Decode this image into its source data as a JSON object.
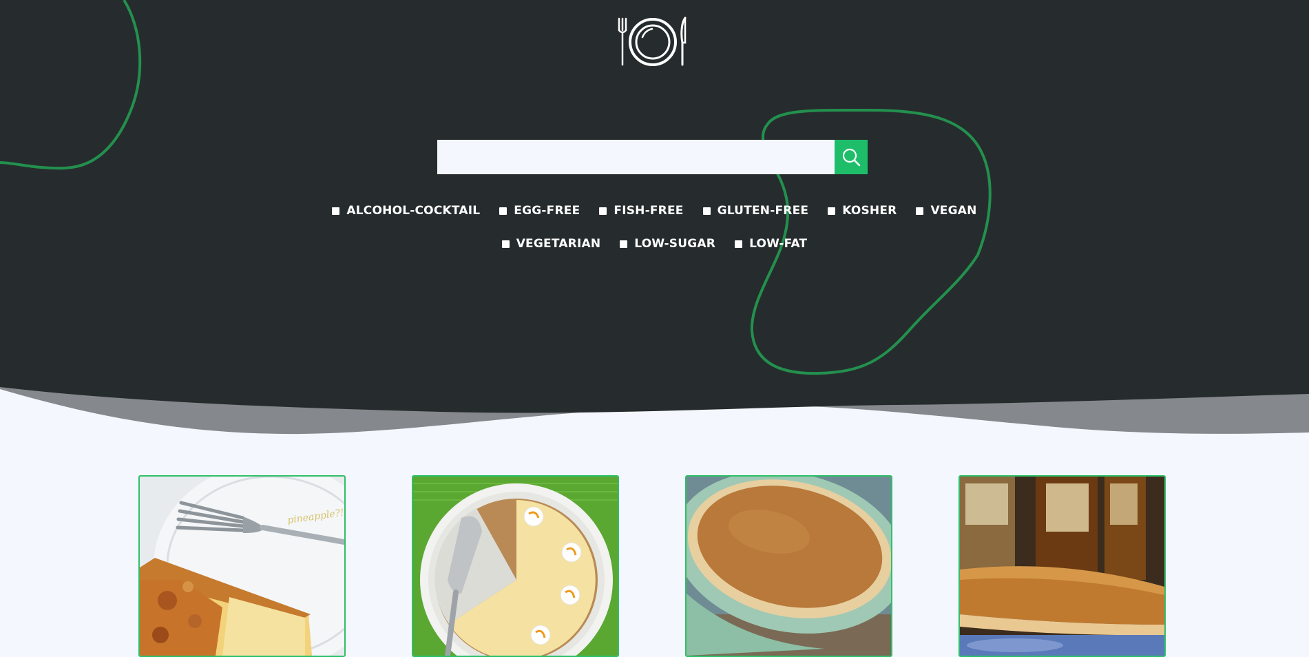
{
  "brand": {
    "logo_icon": "plate-fork-knife-icon"
  },
  "search": {
    "placeholder": "",
    "value": "",
    "button_icon": "search-icon"
  },
  "filters": [
    {
      "label": "ALCOHOL-COCKTAIL",
      "checked": false
    },
    {
      "label": "EGG-FREE",
      "checked": false
    },
    {
      "label": "FISH-FREE",
      "checked": false
    },
    {
      "label": "GLUTEN-FREE",
      "checked": false
    },
    {
      "label": "KOSHER",
      "checked": false
    },
    {
      "label": "VEGAN",
      "checked": false
    },
    {
      "label": "VEGETARIAN",
      "checked": false
    },
    {
      "label": "LOW-SUGAR",
      "checked": false
    },
    {
      "label": "LOW-FAT",
      "checked": false
    }
  ],
  "recipes": [
    {
      "image": "pineapple-pie-slice-with-fork",
      "handwritten_text": "pineapple?!"
    },
    {
      "image": "lemon-cream-pie-with-server"
    },
    {
      "image": "pumpkin-custard-pie"
    },
    {
      "image": "maple-syrup-pie-slice"
    }
  ],
  "colors": {
    "hero_background": "#262c2d",
    "accent_green": "#1ebd6a",
    "page_background": "#f4f7fd",
    "text_light": "#ffffff"
  }
}
